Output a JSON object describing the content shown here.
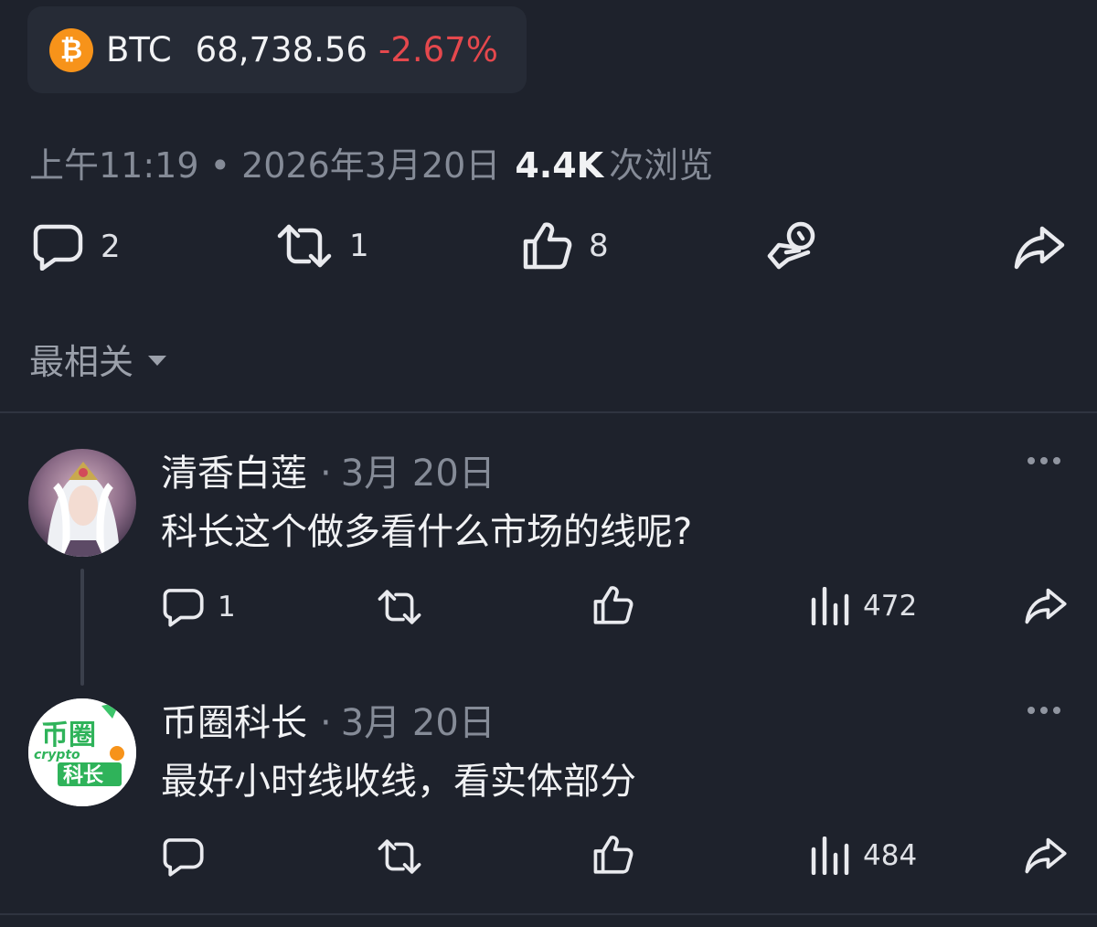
{
  "ticker": {
    "icon": "bitcoin-icon",
    "symbol": "BTC",
    "price": "68,738.56",
    "change": "-2.67%",
    "change_color": "#e5484d",
    "icon_color": "#f7931a"
  },
  "post_meta": {
    "time_date": "上午11:19 • 2026年3月20日",
    "views": "4.4K",
    "views_label": "次浏览"
  },
  "post_actions": {
    "replies": "2",
    "reposts": "1",
    "likes": "8"
  },
  "sort": {
    "label": "最相关"
  },
  "comments": [
    {
      "author": "清香白莲",
      "date": "3月 20日",
      "text": "科长这个做多看什么市场的线呢?",
      "replies": "1",
      "views": "472"
    },
    {
      "author": "币圈科长",
      "date": "3月 20日",
      "text": "最好小时线收线，看实体部分",
      "replies": "",
      "views": "484",
      "avatar_logo": {
        "line1": "币圈",
        "line2": "crypto",
        "line3": "科长"
      }
    }
  ]
}
